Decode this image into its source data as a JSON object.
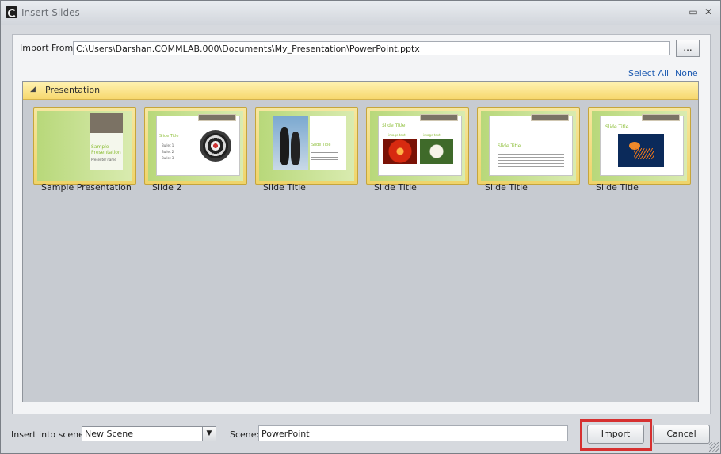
{
  "window": {
    "title": "Insert Slides",
    "minimize_glyph": "▭",
    "close_glyph": "✕"
  },
  "import_from": {
    "label": "Import From:",
    "path": "C:\\Users\\Darshan.COMMLAB.000\\Documents\\My_Presentation\\PowerPoint.pptx",
    "browse_label": "..."
  },
  "selection": {
    "select_all": "Select All",
    "none": "None"
  },
  "group": {
    "toggle_glyph": "◢",
    "title": "Presentation"
  },
  "slides": [
    {
      "caption": "Sample Presentation",
      "thumb_title": "Sample Presentation",
      "thumb_sub": "Presenter name"
    },
    {
      "caption": "Slide 2",
      "thumb_title": "Slide Title",
      "bullets": [
        "Bullet 1",
        "Bullet 2",
        "Bullet 3"
      ]
    },
    {
      "caption": "Slide Title",
      "thumb_title": "Slide Title"
    },
    {
      "caption": "Slide Title",
      "thumb_title": "Slide Title",
      "img1": "image text",
      "img2": "image text"
    },
    {
      "caption": "Slide Title",
      "thumb_title": "Slide Title"
    },
    {
      "caption": "Slide Title",
      "thumb_title": "Slide Title"
    }
  ],
  "bottom": {
    "insert_label": "Insert into scene:",
    "insert_value": "New Scene",
    "scene_label": "Scene:",
    "scene_value": "PowerPoint",
    "import_button": "Import",
    "cancel_button": "Cancel"
  },
  "colors": {
    "link": "#1f5cb2",
    "highlight": "#d63030",
    "group_header": "#f7d86e"
  }
}
